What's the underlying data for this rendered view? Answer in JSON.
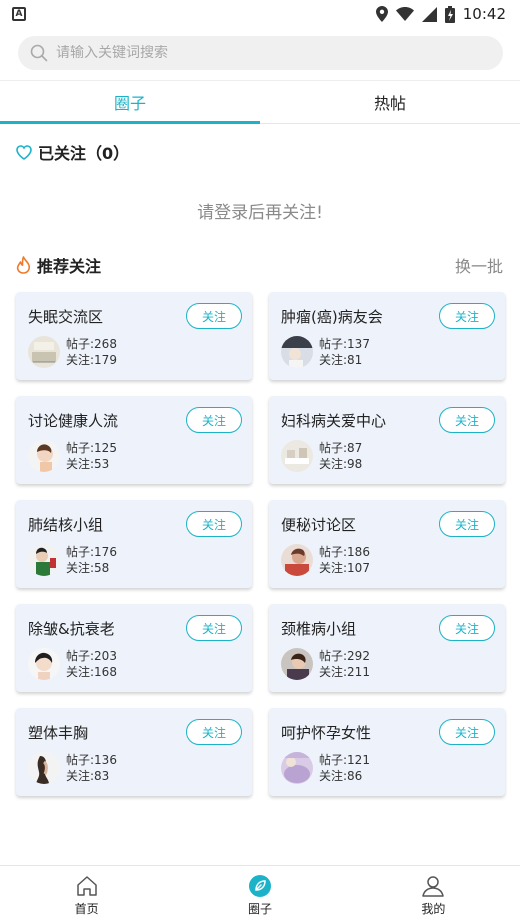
{
  "status": {
    "time": "10:42",
    "left_icon": "a-badge-icon",
    "icons": [
      "location-icon",
      "wifi-icon",
      "signal-icon",
      "battery-icon"
    ]
  },
  "search": {
    "placeholder": "请输入关键词搜索",
    "value": ""
  },
  "tabs": [
    {
      "label": "圈子",
      "active": true
    },
    {
      "label": "热帖",
      "active": false
    }
  ],
  "followed": {
    "label": "已关注（0）",
    "hint": "请登录后再关注!"
  },
  "recommend": {
    "title": "推荐关注",
    "switch_label": "换一批"
  },
  "groups": [
    {
      "name": "失眠交流区",
      "posts": "帖子:268",
      "follows": "关注:179",
      "button": "关注"
    },
    {
      "name": "肿瘤(癌)病友会",
      "posts": "帖子:137",
      "follows": "关注:81",
      "button": "关注"
    },
    {
      "name": "讨论健康人流",
      "posts": "帖子:125",
      "follows": "关注:53",
      "button": "关注"
    },
    {
      "name": "妇科病关爱中心",
      "posts": "帖子:87",
      "follows": "关注:98",
      "button": "关注"
    },
    {
      "name": "肺结核小组",
      "posts": "帖子:176",
      "follows": "关注:58",
      "button": "关注"
    },
    {
      "name": "便秘讨论区",
      "posts": "帖子:186",
      "follows": "关注:107",
      "button": "关注"
    },
    {
      "name": "除皱&抗衰老",
      "posts": "帖子:203",
      "follows": "关注:168",
      "button": "关注"
    },
    {
      "name": "颈椎病小组",
      "posts": "帖子:292",
      "follows": "关注:211",
      "button": "关注"
    },
    {
      "name": "塑体丰胸",
      "posts": "帖子:136",
      "follows": "关注:83",
      "button": "关注"
    },
    {
      "name": "呵护怀孕女性",
      "posts": "帖子:121",
      "follows": "关注:86",
      "button": "关注"
    }
  ],
  "nav": [
    {
      "label": "首页"
    },
    {
      "label": "圈子"
    },
    {
      "label": "我的"
    }
  ],
  "colors": {
    "accent": "#1cb3c8",
    "card_bg": "#eef3fb",
    "flame": "#f07a2a"
  }
}
